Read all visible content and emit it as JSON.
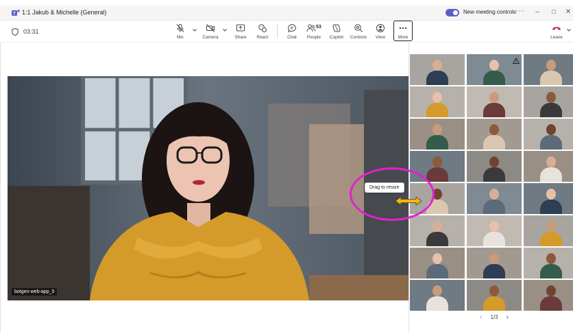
{
  "titlebar": {
    "title": "1:1 Jakub & Michelle (General)",
    "toggle_label": "New meeting controls",
    "toggle_on": true,
    "more_glyph": "···",
    "minimize": "–",
    "maximize": "□",
    "close": "✕"
  },
  "toolbar": {
    "timer": "03:31",
    "mic_label": "Mic",
    "camera_label": "Camera",
    "share_label": "Share",
    "react_label": "React",
    "chat_label": "Chat",
    "people_label": "People",
    "people_count": "53",
    "copilot_label": "Copilot",
    "controls_label": "Controls",
    "view_label": "View",
    "more_label": "More",
    "leave_label": "Leave"
  },
  "main": {
    "participant_name": "botgen-web-app_5"
  },
  "resize": {
    "tooltip": "Drag to resize"
  },
  "pager": {
    "prev": "‹",
    "text": "1/3",
    "next": "›"
  },
  "colors": {
    "accent": "#5b5fc7",
    "leave_red": "#c4314b",
    "highlight_ring": "#e41fd2",
    "arrow_fill": "#f5b800"
  },
  "icons": {
    "mic": "mic-off-icon",
    "camera": "camera-off-icon",
    "share": "share-icon",
    "react": "react-icon",
    "chat": "chat-icon",
    "people": "people-icon",
    "copilot": "copilot-icon",
    "controls": "controls-icon",
    "view": "view-icon",
    "more": "more-icon",
    "leave": "phone-hangup-icon"
  }
}
